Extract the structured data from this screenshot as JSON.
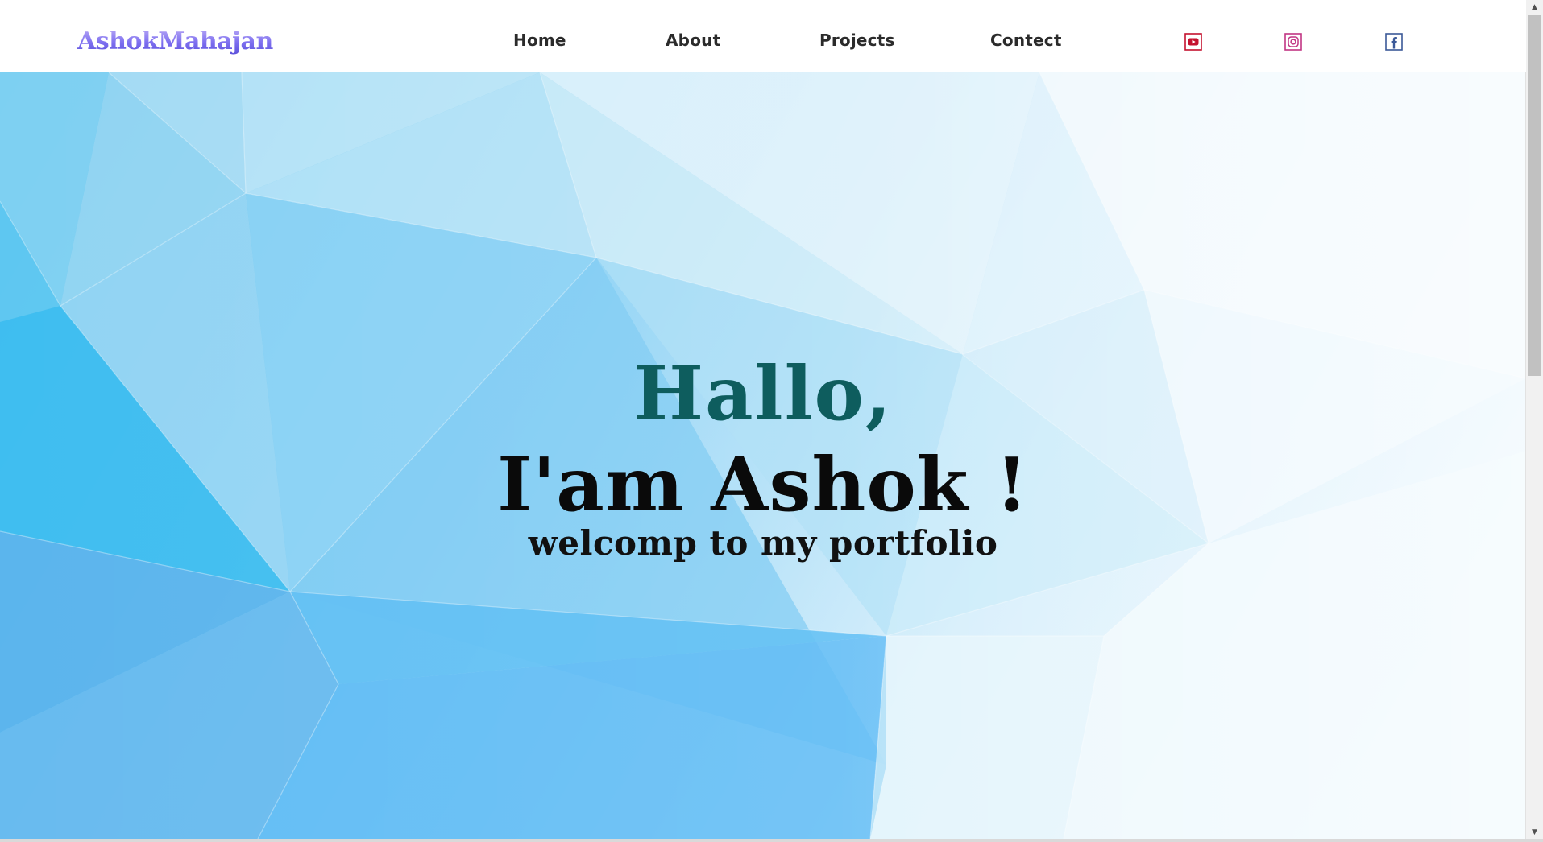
{
  "navbar": {
    "logo": "AshokMahajan",
    "links": [
      {
        "label": "Home"
      },
      {
        "label": "About"
      },
      {
        "label": "Projects"
      },
      {
        "label": "Contect"
      }
    ],
    "social": [
      {
        "icon": "youtube-icon",
        "color": "#c4122f"
      },
      {
        "icon": "instagram-icon",
        "color": "#c13584"
      },
      {
        "icon": "facebook-icon",
        "color": "#3b5998"
      }
    ]
  },
  "hero": {
    "greeting": "Hallo,",
    "headline": "I'am Ashok !",
    "subline": "welcomp to my portfolio"
  },
  "colors": {
    "greeting": "#0e5d5e",
    "headline": "#0a0a0a",
    "logo_gradient": [
      "#b9a9f5",
      "#5a4fd8"
    ]
  }
}
